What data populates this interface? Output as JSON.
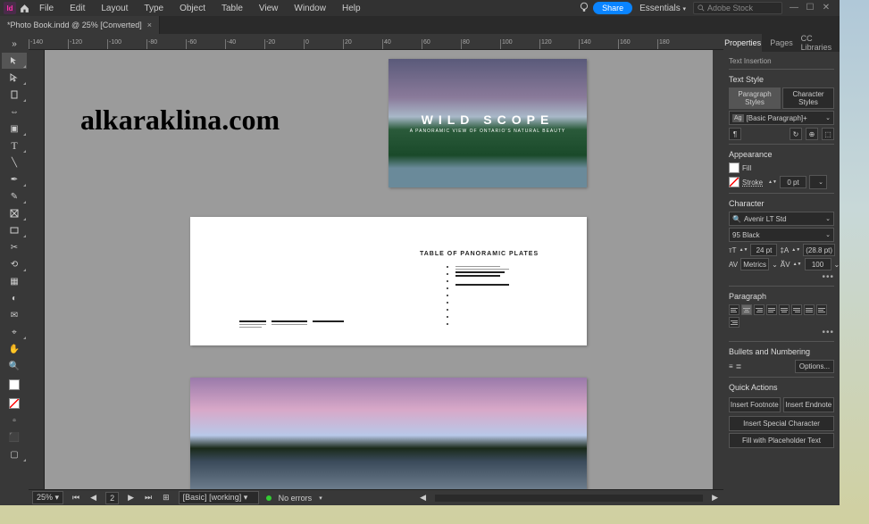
{
  "menu": {
    "items": [
      "File",
      "Edit",
      "Layout",
      "Type",
      "Object",
      "Table",
      "View",
      "Window",
      "Help"
    ],
    "share": "Share",
    "workspace": "Essentials",
    "search_placeholder": "Adobe Stock"
  },
  "tab": {
    "title": "*Photo Book.indd @ 25% [Converted]"
  },
  "watermark": "alkaraklina.com",
  "ruler_ticks": [
    "-140",
    "-120",
    "-100",
    "-80",
    "-60",
    "-40",
    "-20",
    "0",
    "20",
    "40",
    "60",
    "80",
    "100",
    "120",
    "140",
    "160",
    "180"
  ],
  "spread1": {
    "title": "WILD SCOPE",
    "subtitle": "A PANORAMIC VIEW OF ONTARIO'S NATURAL BEAUTY"
  },
  "spread2": {
    "toc_title": "TABLE OF PANORAMIC PLATES"
  },
  "status": {
    "zoom": "25%",
    "page": "2",
    "master": "[Basic] [working]",
    "errors": "No errors"
  },
  "panels": {
    "tabs": [
      "Properties",
      "Pages",
      "CC Libraries"
    ],
    "context": "Text Insertion",
    "textstyle": {
      "title": "Text Style",
      "pstyles": "Paragraph Styles",
      "cstyles": "Character Styles",
      "style_name": "[Basic Paragraph]+"
    },
    "appearance": {
      "title": "Appearance",
      "fill": "Fill",
      "stroke": "Stroke",
      "stroke_val": "0 pt"
    },
    "character": {
      "title": "Character",
      "font": "Avenir LT Std",
      "weight": "95 Black",
      "size": "24 pt",
      "leading": "(28.8 pt)",
      "kerning": "Metrics",
      "tracking": "100"
    },
    "paragraph": {
      "title": "Paragraph"
    },
    "bullets": {
      "title": "Bullets and Numbering",
      "options": "Options..."
    },
    "quick": {
      "title": "Quick Actions",
      "footnote": "Insert Footnote",
      "endnote": "Insert Endnote",
      "special": "Insert Special Character",
      "placeholder": "Fill with Placeholder Text"
    }
  }
}
